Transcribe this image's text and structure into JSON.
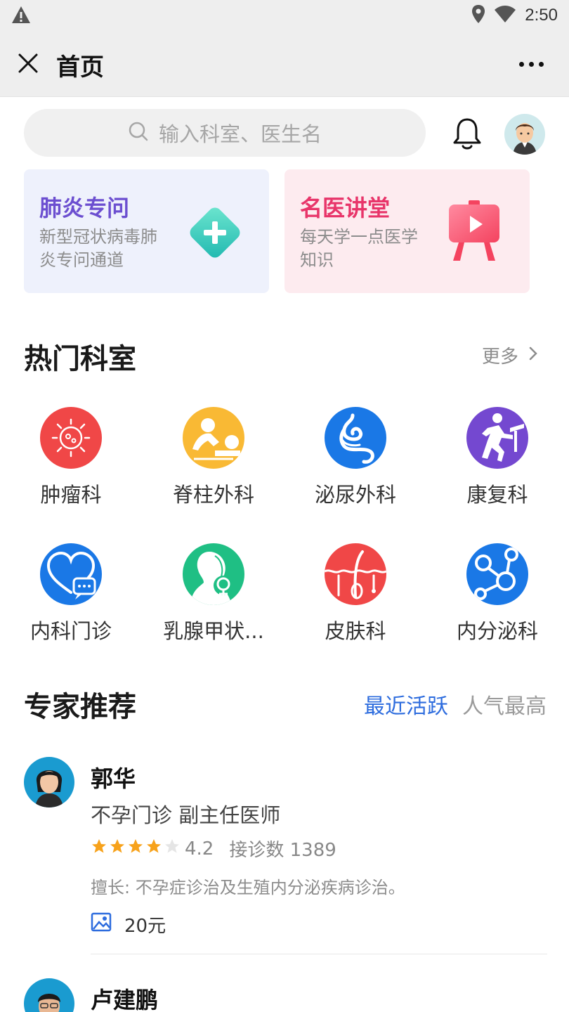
{
  "status_bar": {
    "time": "2:50"
  },
  "title_bar": {
    "title": "首页"
  },
  "search": {
    "placeholder": "输入科室、医生名"
  },
  "promo_cards": [
    {
      "title": "肺炎专问",
      "subtitle": "新型冠状病毒肺炎专问通道"
    },
    {
      "title": "名医讲堂",
      "subtitle": "每天学一点医学知识"
    }
  ],
  "departments_section": {
    "title": "热门科室",
    "more": "更多",
    "items": [
      {
        "label": "肿瘤科",
        "color": "#f04747",
        "icon": "virus-icon"
      },
      {
        "label": "脊柱外科",
        "color": "#f9b934",
        "icon": "massage-icon"
      },
      {
        "label": "泌尿外科",
        "color": "#1a78e6",
        "icon": "intestine-icon"
      },
      {
        "label": "康复科",
        "color": "#7448d0",
        "icon": "running-icon"
      },
      {
        "label": "内科门诊",
        "color": "#1a78e6",
        "icon": "heart-chat-icon"
      },
      {
        "label": "乳腺甲状...",
        "color": "#1fbf84",
        "icon": "female-icon"
      },
      {
        "label": "皮肤科",
        "color": "#f04747",
        "icon": "hair-skin-icon"
      },
      {
        "label": "内分泌科",
        "color": "#1a78e6",
        "icon": "molecule-icon"
      }
    ]
  },
  "experts_section": {
    "title": "专家推荐",
    "tabs": [
      {
        "label": "最近活跃",
        "active": true
      },
      {
        "label": "人气最高",
        "active": false
      }
    ],
    "doctors": [
      {
        "name": "郭华",
        "role": "不孕门诊  副主任医师",
        "rating": 4.2,
        "rating_text": "4.2",
        "consult": "接诊数 1389",
        "skill": "擅长: 不孕症诊治及生殖内分泌疾病诊治。",
        "price": "20元"
      },
      {
        "name": "卢建鹏"
      }
    ]
  },
  "colors": {
    "accent": "#2d6cde",
    "star": "#f7a21b"
  }
}
